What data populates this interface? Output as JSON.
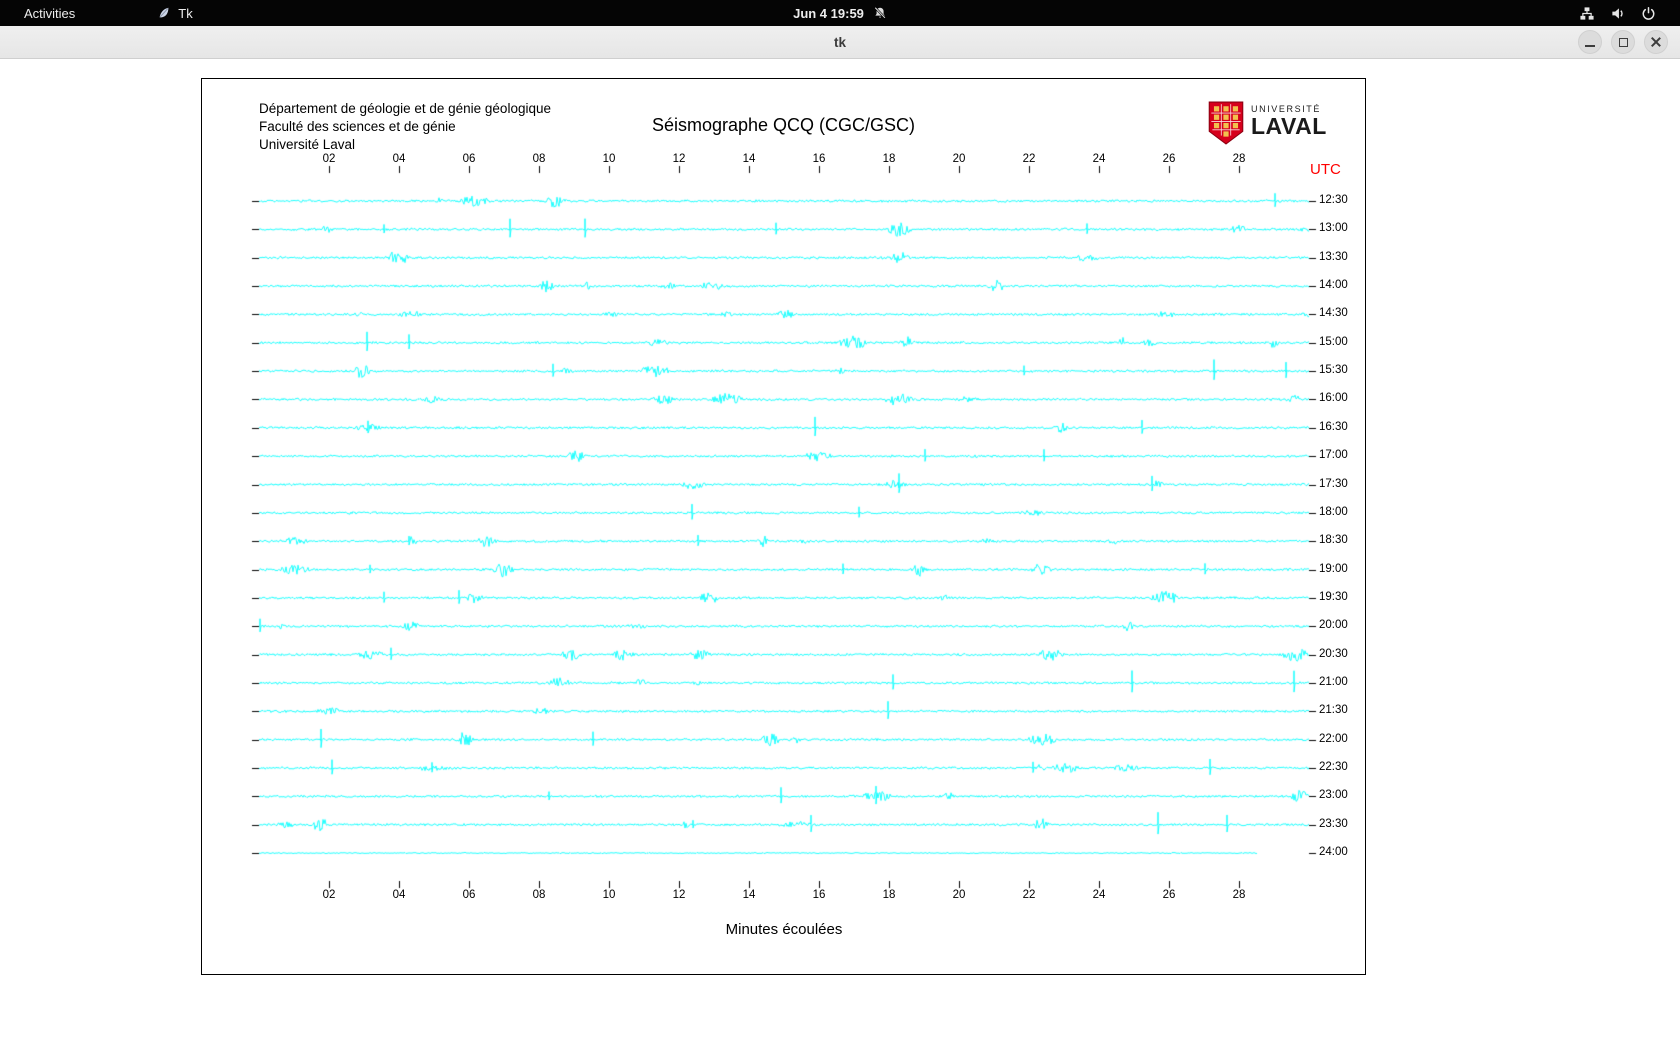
{
  "topbar": {
    "activities_label": "Activities",
    "app_menu": {
      "label": "Tk"
    },
    "clock_label": "Jun 4 19:59"
  },
  "window": {
    "title": "tk"
  },
  "seismograph": {
    "institution_lines": [
      "Département de géologie et de génie géologique",
      "Faculté des sciences et de génie",
      "Université Laval"
    ],
    "title": "Séismographe QCQ (CGC/GSC)",
    "logo": {
      "top": "UNIVERSITÉ",
      "bottom": "LAVAL",
      "shield_color": "#d6001c",
      "diamond_color": "#f2c14e"
    },
    "utc_label": "UTC",
    "utc_color": "#ff0000",
    "xlabel": "Minutes écoulées",
    "trace_color": "#00ffff",
    "chart_data": {
      "type": "line",
      "title": "Séismographe QCQ (CGC/GSC)",
      "xlabel": "Minutes écoulées",
      "x_range_minutes": [
        0,
        30
      ],
      "x_tick_labels": [
        "02",
        "04",
        "06",
        "08",
        "10",
        "12",
        "14",
        "16",
        "18",
        "20",
        "22",
        "24",
        "26",
        "28"
      ],
      "right_axis_label": "UTC",
      "trace_time_labels": [
        "12:30",
        "13:00",
        "13:30",
        "14:00",
        "14:30",
        "15:00",
        "15:30",
        "16:00",
        "16:30",
        "17:00",
        "17:30",
        "18:00",
        "18:30",
        "19:00",
        "19:30",
        "20:00",
        "20:30",
        "21:00",
        "21:30",
        "22:00",
        "22:30",
        "23:00",
        "23:30",
        "24:00"
      ],
      "traces": "continuous seismic noise with intermittent spikes; final 24:00 trace quieter and truncated",
      "last_trace_fraction": 0.95
    }
  }
}
